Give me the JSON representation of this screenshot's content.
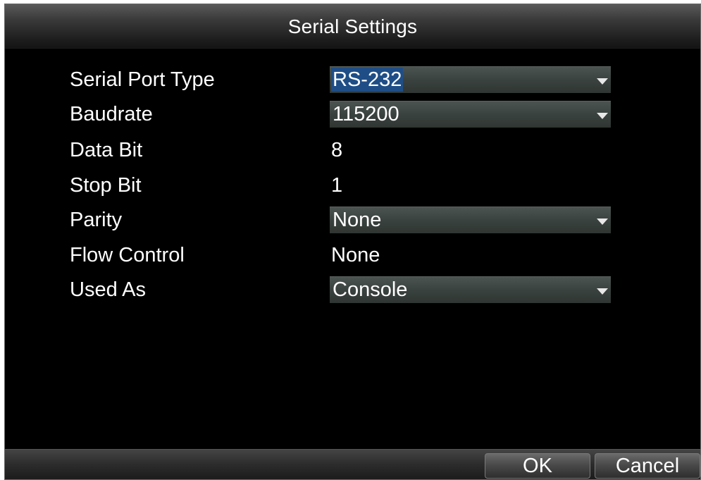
{
  "window": {
    "title": "Serial Settings"
  },
  "fields": [
    {
      "label": "Serial Port Type",
      "value": "RS-232",
      "control": "select",
      "focused": true
    },
    {
      "label": "Baudrate",
      "value": "115200",
      "control": "select",
      "focused": false
    },
    {
      "label": "Data Bit",
      "value": "8",
      "control": "text"
    },
    {
      "label": "Stop Bit",
      "value": "1",
      "control": "text"
    },
    {
      "label": "Parity",
      "value": "None",
      "control": "select",
      "focused": false
    },
    {
      "label": "Flow Control",
      "value": "None",
      "control": "text"
    },
    {
      "label": "Used As",
      "value": "Console",
      "control": "select",
      "focused": false
    }
  ],
  "buttons": {
    "ok_label": "OK",
    "cancel_label": "Cancel"
  },
  "icons": {
    "dropdown": "chevron-down-icon"
  },
  "colors": {
    "background": "#000000",
    "selection_highlight": "#1f4e86",
    "select_field": "#3a423f",
    "text": "#ffffff"
  }
}
